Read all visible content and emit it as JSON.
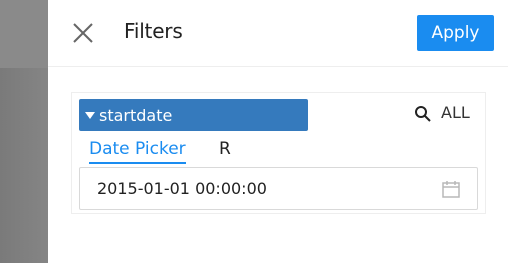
{
  "icons": {
    "close": "close-icon",
    "search": "search-icon",
    "calendar": "calendar-icon",
    "caret": "caret-down-icon"
  },
  "colors": {
    "accent": "#1a8cf0",
    "chip_bg": "#357abd",
    "overlay": "#808080"
  },
  "header": {
    "title": "Filters",
    "apply_label": "Apply"
  },
  "filter": {
    "field_name": "startdate",
    "all_label": "ALL",
    "tabs": [
      {
        "label": "Date Picker",
        "active": true
      },
      {
        "label": "R",
        "active": false
      }
    ],
    "date_value": "2015-01-01 00:00:00"
  }
}
